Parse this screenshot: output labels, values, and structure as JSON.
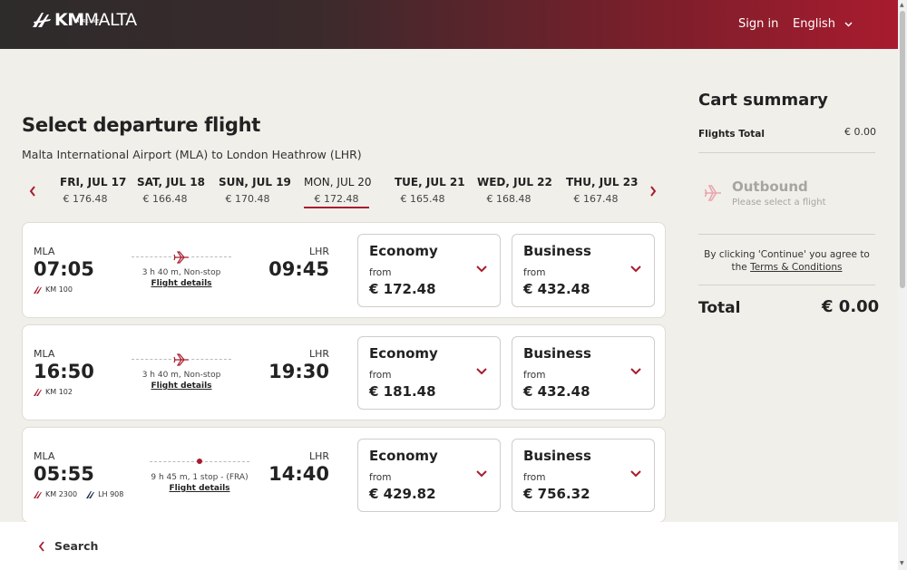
{
  "header": {
    "logo_main": "KM",
    "logo_thin": "MALTA",
    "logo_sub": "AIRLINES",
    "sign_in": "Sign in",
    "language": "English",
    "bg_start": "#2e2b2b",
    "bg_end": "#a81b2e"
  },
  "main": {
    "title": "Select departure flight",
    "route": "Malta International Airport (MLA) to London Heathrow (LHR)",
    "dates": [
      {
        "day": "FRI, JUL 17",
        "price": "€ 176.48"
      },
      {
        "day": "SAT, JUL 18",
        "price": "€ 166.48"
      },
      {
        "day": "SUN, JUL 19",
        "price": "€ 170.48"
      },
      {
        "day": "MON, JUL 20",
        "price": "€ 172.48"
      },
      {
        "day": "TUE, JUL 21",
        "price": "€ 165.48"
      },
      {
        "day": "WED, JUL 22",
        "price": "€ 168.48"
      },
      {
        "day": "THU, JUL 23",
        "price": "€ 167.48"
      }
    ],
    "selected_date_index": 3,
    "flights": [
      {
        "from": "MLA",
        "dep": "07:05",
        "to": "LHR",
        "arr": "09:45",
        "flight_numbers": [
          "KM 100"
        ],
        "duration": "3 h 40 m, Non-stop",
        "details": "Flight details",
        "economy": {
          "label": "Economy",
          "from": "from",
          "price": "€ 172.48"
        },
        "business": {
          "label": "Business",
          "from": "from",
          "price": "€ 432.48"
        }
      },
      {
        "from": "MLA",
        "dep": "16:50",
        "to": "LHR",
        "arr": "19:30",
        "flight_numbers": [
          "KM 102"
        ],
        "duration": "3 h 40 m, Non-stop",
        "details": "Flight details",
        "economy": {
          "label": "Economy",
          "from": "from",
          "price": "€ 181.48"
        },
        "business": {
          "label": "Business",
          "from": "from",
          "price": "€ 432.48"
        }
      },
      {
        "from": "MLA",
        "dep": "05:55",
        "to": "LHR",
        "arr": "14:40",
        "flight_numbers": [
          "KM 2300",
          "LH 908"
        ],
        "duration": "9 h 45 m, 1 stop - (FRA)",
        "details": "Flight details",
        "economy": {
          "label": "Economy",
          "from": "from",
          "price": "€ 429.82"
        },
        "business": {
          "label": "Business",
          "from": "from",
          "price": "€ 756.32"
        }
      }
    ]
  },
  "cart": {
    "title": "Cart summary",
    "flights_total_label": "Flights Total",
    "flights_total_value": "€ 0.00",
    "outbound_title": "Outbound",
    "outbound_sub": "Please select a flight",
    "terms_prefix": "By clicking 'Continue' you agree to the ",
    "terms_link": "Terms & Conditions",
    "total_label": "Total",
    "total_value": "€ 0.00"
  },
  "footer": {
    "search": "Search"
  },
  "colors": {
    "accent": "#a81b2e",
    "page_bg": "#f0efea",
    "muted": "#a7a5a0"
  },
  "icons": {
    "prev": "chevron-left-icon",
    "next": "chevron-right-icon",
    "plane": "plane-icon",
    "fare_toggle": "chevron-down-icon",
    "back": "chevron-left-icon"
  }
}
